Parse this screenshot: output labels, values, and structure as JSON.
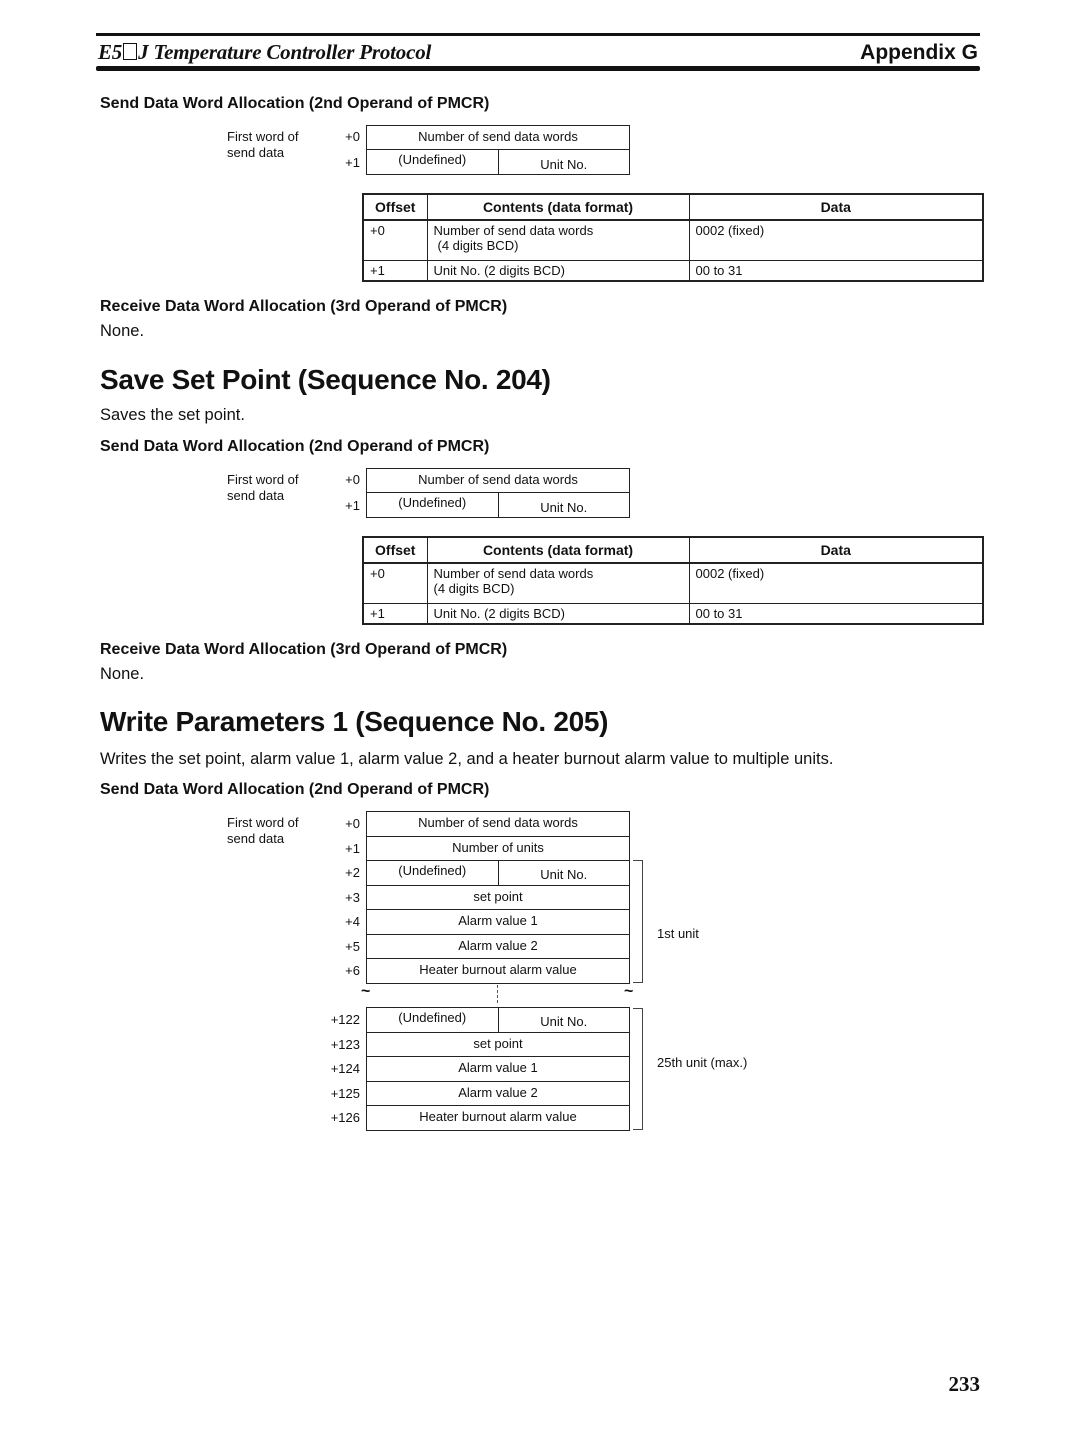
{
  "header": {
    "title_prefix": "E5",
    "title_suffix": "J Temperature Controller Protocol",
    "appendix": "Appendix G"
  },
  "section1": {
    "send_heading": "Send Data Word Allocation (2nd Operand of PMCR)",
    "first_word_label_1": "First word of",
    "first_word_label_2": "send data",
    "words": [
      {
        "offset": "+0",
        "content": "Number of send data words"
      },
      {
        "offset": "+1",
        "left": "(Undefined)",
        "right": "Unit No."
      }
    ],
    "table": {
      "headers": [
        "Offset",
        "Contents (data format)",
        "Data"
      ],
      "rows": [
        {
          "offset": "+0",
          "contents_1": "Number of send data words",
          "contents_2": "(4 digits BCD)",
          "data": "0002 (fixed)"
        },
        {
          "offset": "+1",
          "contents_1": "Unit No. (2 digits BCD)",
          "data": "00 to 31"
        }
      ]
    },
    "receive_heading": "Receive Data Word Allocation (3rd Operand of PMCR)",
    "receive_value": "None."
  },
  "section2": {
    "title": "Save Set Point (Sequence No. 204)",
    "description": "Saves the set point.",
    "send_heading": "Send Data Word Allocation (2nd Operand of PMCR)",
    "first_word_label_1": "First word of",
    "first_word_label_2": "send data",
    "words": [
      {
        "offset": "+0",
        "content": "Number of send data words"
      },
      {
        "offset": "+1",
        "left": "(Undefined)",
        "right": "Unit No."
      }
    ],
    "table": {
      "headers": [
        "Offset",
        "Contents (data format)",
        "Data"
      ],
      "rows": [
        {
          "offset": "+0",
          "contents_1": "Number of send data words",
          "contents_2": "(4 digits BCD)",
          "data": "0002 (fixed)"
        },
        {
          "offset": "+1",
          "contents_1": "Unit No. (2 digits BCD)",
          "data": "00 to 31"
        }
      ]
    },
    "receive_heading": "Receive Data Word Allocation (3rd Operand of PMCR)",
    "receive_value": "None."
  },
  "section3": {
    "title": "Write Parameters 1 (Sequence No. 205)",
    "description": "Writes the set point, alarm value 1, alarm value 2, and a heater burnout alarm value to multiple units.",
    "send_heading": "Send Data Word Allocation (2nd Operand of PMCR)",
    "first_word_label_1": "First word of",
    "first_word_label_2": "send data",
    "words_top": [
      {
        "offset": "+0",
        "content": "Number of send data words"
      },
      {
        "offset": "+1",
        "content": "Number of units"
      },
      {
        "offset": "+2",
        "left": "(Undefined)",
        "right": "Unit No."
      },
      {
        "offset": "+3",
        "content": "set point"
      },
      {
        "offset": "+4",
        "content": "Alarm value 1"
      },
      {
        "offset": "+5",
        "content": "Alarm value 2"
      },
      {
        "offset": "+6",
        "content": "Heater burnout alarm value"
      }
    ],
    "words_bottom": [
      {
        "offset": "+122",
        "left": "(Undefined)",
        "right": "Unit No."
      },
      {
        "offset": "+123",
        "content": "set point"
      },
      {
        "offset": "+124",
        "content": "Alarm value 1"
      },
      {
        "offset": "+125",
        "content": "Alarm value 2"
      },
      {
        "offset": "+126",
        "content": "Heater burnout alarm value"
      }
    ],
    "break_mark": "~",
    "bracket_first": "1st unit",
    "bracket_last": "25th unit (max.)"
  },
  "page_number": "233"
}
